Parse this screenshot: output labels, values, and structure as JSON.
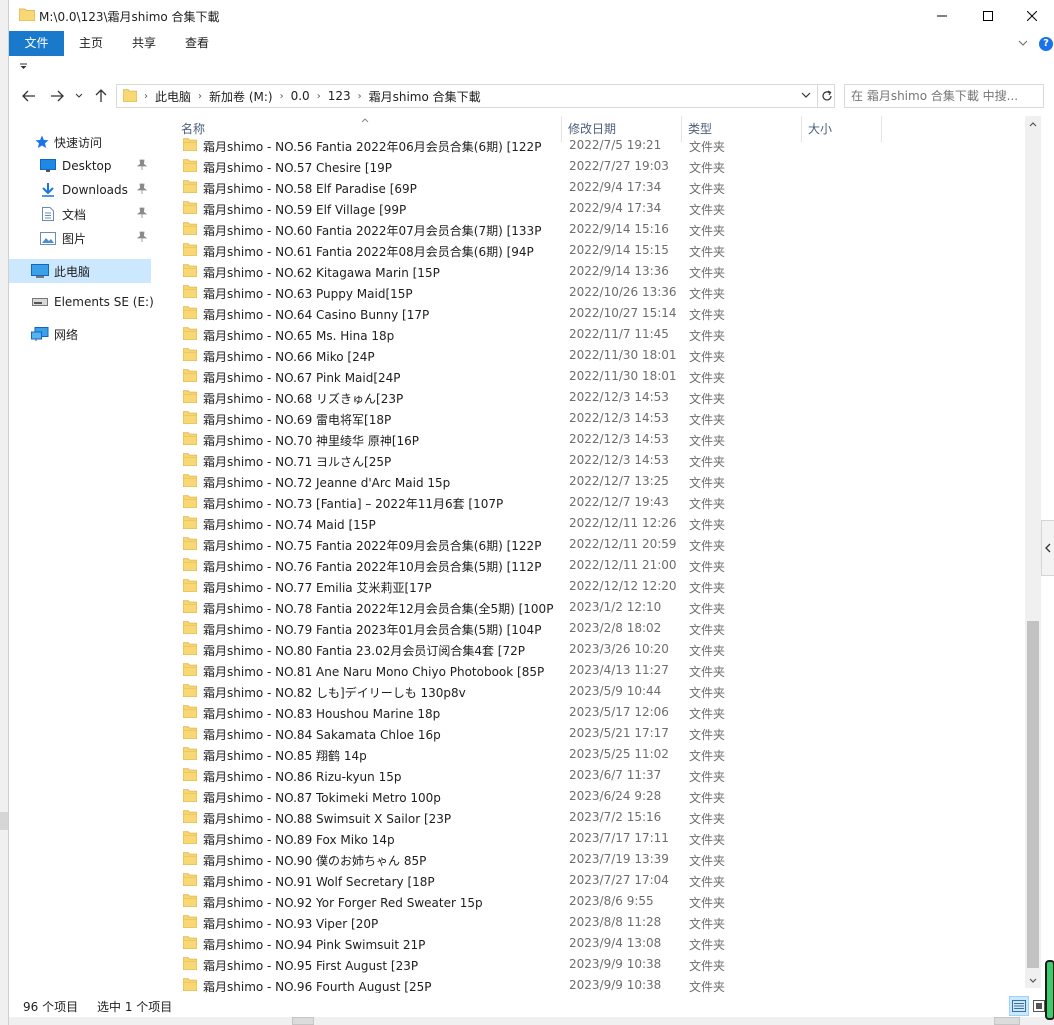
{
  "window": {
    "title": "M:\\0.0\\123\\霜月shimo 合集下載"
  },
  "ribbon": {
    "tabs": [
      "文件",
      "主页",
      "共享",
      "查看"
    ]
  },
  "address": {
    "crumbs": [
      "此电脑",
      "新加卷 (M:)",
      "0.0",
      "123",
      "霜月shimo 合集下載"
    ]
  },
  "search": {
    "placeholder": "在 霜月shimo 合集下載 中搜..."
  },
  "nav": {
    "quick_access": "快速访问",
    "desktop": "Desktop",
    "downloads": "Downloads",
    "documents": "文档",
    "pictures": "图片",
    "this_pc": "此电脑",
    "elements": "Elements SE (E:)",
    "network": "网络"
  },
  "columns": {
    "name": "名称",
    "date": "修改日期",
    "type": "类型",
    "size": "大小"
  },
  "files": [
    {
      "name": "霜月shimo - NO.56 Fantia 2022年06月会员合集(6期) [122P",
      "date": "2022/7/5 19:21",
      "type": "文件夹"
    },
    {
      "name": "霜月shimo - NO.57 Chesire [19P",
      "date": "2022/7/27 19:03",
      "type": "文件夹"
    },
    {
      "name": "霜月shimo - NO.58 Elf Paradise [69P",
      "date": "2022/9/4 17:34",
      "type": "文件夹"
    },
    {
      "name": "霜月shimo - NO.59 Elf Village [99P",
      "date": "2022/9/4 17:34",
      "type": "文件夹"
    },
    {
      "name": "霜月shimo - NO.60 Fantia 2022年07月会员合集(7期) [133P",
      "date": "2022/9/14 15:16",
      "type": "文件夹"
    },
    {
      "name": "霜月shimo - NO.61 Fantia 2022年08月会员合集(6期) [94P",
      "date": "2022/9/14 15:15",
      "type": "文件夹"
    },
    {
      "name": "霜月shimo - NO.62 Kitagawa Marin [15P",
      "date": "2022/9/14 13:36",
      "type": "文件夹"
    },
    {
      "name": "霜月shimo - NO.63 Puppy Maid[15P",
      "date": "2022/10/26 13:36",
      "type": "文件夹"
    },
    {
      "name": "霜月shimo - NO.64 Casino Bunny [17P",
      "date": "2022/10/27 15:14",
      "type": "文件夹"
    },
    {
      "name": "霜月shimo - NO.65 Ms. Hina 18p",
      "date": "2022/11/7 11:45",
      "type": "文件夹"
    },
    {
      "name": "霜月shimo - NO.66 Miko [24P",
      "date": "2022/11/30 18:01",
      "type": "文件夹"
    },
    {
      "name": "霜月shimo - NO.67 Pink Maid[24P",
      "date": "2022/11/30 18:01",
      "type": "文件夹"
    },
    {
      "name": "霜月shimo - NO.68 リズきゅん[23P",
      "date": "2022/12/3 14:53",
      "type": "文件夹"
    },
    {
      "name": "霜月shimo - NO.69 雷电将军[18P",
      "date": "2022/12/3 14:53",
      "type": "文件夹"
    },
    {
      "name": "霜月shimo - NO.70 神里绫华 原神[16P",
      "date": "2022/12/3 14:53",
      "type": "文件夹"
    },
    {
      "name": "霜月shimo - NO.71 ヨルさん[25P",
      "date": "2022/12/3 14:53",
      "type": "文件夹"
    },
    {
      "name": "霜月shimo - NO.72 Jeanne d'Arc Maid 15p",
      "date": "2022/12/7 13:25",
      "type": "文件夹"
    },
    {
      "name": "霜月shimo - NO.73 [Fantia] – 2022年11月6套 [107P",
      "date": "2022/12/7 19:43",
      "type": "文件夹"
    },
    {
      "name": "霜月shimo - NO.74 Maid [15P",
      "date": "2022/12/11 12:26",
      "type": "文件夹"
    },
    {
      "name": "霜月shimo - NO.75 Fantia 2022年09月会员合集(6期) [122P",
      "date": "2022/12/11 20:59",
      "type": "文件夹"
    },
    {
      "name": "霜月shimo - NO.76 Fantia 2022年10月会员合集(5期) [112P",
      "date": "2022/12/11 21:00",
      "type": "文件夹"
    },
    {
      "name": "霜月shimo - NO.77 Emilia 艾米莉亚[17P",
      "date": "2022/12/12 12:20",
      "type": "文件夹"
    },
    {
      "name": "霜月shimo - NO.78 Fantia 2022年12月会员合集(全5期) [100P",
      "date": "2023/1/2 12:10",
      "type": "文件夹"
    },
    {
      "name": "霜月shimo - NO.79 Fantia 2023年01月会员合集(5期) [104P",
      "date": "2023/2/8 18:02",
      "type": "文件夹"
    },
    {
      "name": "霜月shimo - NO.80 Fantia 23.02月会员订阅合集4套 [72P",
      "date": "2023/3/26 10:20",
      "type": "文件夹"
    },
    {
      "name": "霜月shimo - NO.81 Ane Naru Mono Chiyo Photobook [85P",
      "date": "2023/4/13 11:27",
      "type": "文件夹"
    },
    {
      "name": "霜月shimo - NO.82 しも]デイリーしも 130p8v",
      "date": "2023/5/9 10:44",
      "type": "文件夹"
    },
    {
      "name": "霜月shimo - NO.83 Houshou Marine 18p",
      "date": "2023/5/17 12:06",
      "type": "文件夹"
    },
    {
      "name": "霜月shimo - NO.84 Sakamata Chloe 16p",
      "date": "2023/5/21 17:17",
      "type": "文件夹"
    },
    {
      "name": "霜月shimo - NO.85 翔鹤 14p",
      "date": "2023/5/25 11:02",
      "type": "文件夹"
    },
    {
      "name": "霜月shimo - NO.86 Rizu-kyun 15p",
      "date": "2023/6/7 11:37",
      "type": "文件夹"
    },
    {
      "name": "霜月shimo - NO.87 Tokimeki Metro 100p",
      "date": "2023/6/24 9:28",
      "type": "文件夹"
    },
    {
      "name": "霜月shimo - NO.88 Swimsuit X Sailor [23P",
      "date": "2023/7/2 15:16",
      "type": "文件夹"
    },
    {
      "name": "霜月shimo - NO.89 Fox Miko 14p",
      "date": "2023/7/17 17:11",
      "type": "文件夹"
    },
    {
      "name": "霜月shimo - NO.90 僕のお姉ちゃん 85P",
      "date": "2023/7/19 13:39",
      "type": "文件夹"
    },
    {
      "name": "霜月shimo - NO.91 Wolf Secretary [18P",
      "date": "2023/7/27 17:04",
      "type": "文件夹"
    },
    {
      "name": "霜月shimo - NO.92 Yor Forger  Red Sweater 15p",
      "date": "2023/8/6 9:55",
      "type": "文件夹"
    },
    {
      "name": "霜月shimo - NO.93 Viper [20P",
      "date": "2023/8/8 11:28",
      "type": "文件夹"
    },
    {
      "name": "霜月shimo - NO.94 Pink Swimsuit 21P",
      "date": "2023/9/4 13:08",
      "type": "文件夹"
    },
    {
      "name": "霜月shimo - NO.95 First August [23P",
      "date": "2023/9/9 10:38",
      "type": "文件夹"
    },
    {
      "name": "霜月shimo - NO.96 Fourth August [25P",
      "date": "2023/9/9 10:38",
      "type": "文件夹"
    }
  ],
  "status": {
    "count": "96 个项目",
    "selected": "选中 1 个项目"
  },
  "colors": {
    "accent": "#1979ca",
    "folder": "#f8d775",
    "selection": "#cce8ff"
  }
}
